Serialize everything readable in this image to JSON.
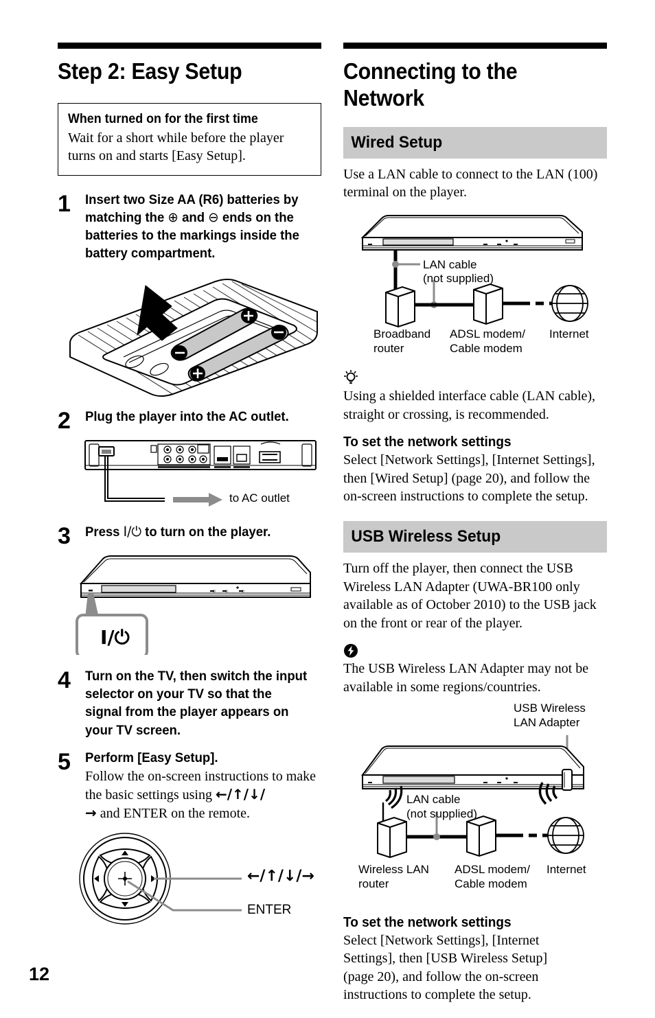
{
  "page": {
    "number": "12"
  },
  "left": {
    "rule": true,
    "title": "Step 2: Easy Setup",
    "first_time_box": {
      "heading": "When turned on for the first time",
      "text": "Wait for a short while before the player turns on and starts [Easy Setup]."
    },
    "steps": [
      {
        "num": "1",
        "heading_a": "Insert two Size AA (R6) batteries by matching the ",
        "plus": "⊕",
        "heading_b": " and ",
        "minus": "⊖",
        "heading_c": " ends on the batteries to the markings inside the battery compartment.",
        "figure": "remote-battery-compartment"
      },
      {
        "num": "2",
        "heading": "Plug the player into the AC outlet.",
        "figure": "player-rear-panel",
        "callout": "to AC outlet"
      },
      {
        "num": "3",
        "heading_a": "Press ",
        "power_symbol": "I/⏻",
        "heading_b": " to turn on the player.",
        "figure": "player-front-power-button",
        "callout": "I/⏻"
      },
      {
        "num": "4",
        "heading": "Turn on the TV, then switch the input selector on your TV so that the signal from the player appears on your TV screen."
      },
      {
        "num": "5",
        "heading": "Perform [Easy Setup].",
        "sub_a": "Follow the on-screen instructions to make the basic settings using ",
        "arrows_1": "←/↑/↓/",
        "arrows_2": "→",
        "sub_b": " and ENTER on the remote.",
        "figure": "remote-dpad",
        "callout_arrows": "←/↑/↓/→",
        "callout_enter": "ENTER"
      }
    ]
  },
  "right": {
    "rule": true,
    "title": "Connecting to the Network",
    "wired": {
      "band": "Wired Setup",
      "intro": "Use a LAN cable to connect to the LAN (100) terminal on the player.",
      "diagram": {
        "lan_cable_label_1": "LAN cable",
        "lan_cable_label_2": "(not supplied)",
        "router_label_1": "Broadband",
        "router_label_2": "router",
        "modem_label_1": "ADSL modem/",
        "modem_label_2": "Cable modem",
        "internet_label": "Internet"
      },
      "tip_icon": "lightbulb-tip-icon",
      "tip_text": "Using a shielded interface cable (LAN cable), straight or crossing, is recommended.",
      "settings_heading": "To set the network settings",
      "settings_text": "Select [Network Settings], [Internet Settings], then [Wired Setup] (page 20), and follow the on-screen instructions to complete the setup."
    },
    "usb": {
      "band": "USB Wireless Setup",
      "intro": "Turn off the player, then connect the USB Wireless LAN Adapter (UWA-BR100 only available as of October 2010) to the USB jack on the front or rear of the player.",
      "note_icon": "lightning-note-icon",
      "note_text": "The USB Wireless LAN Adapter may not be available in some regions/countries.",
      "diagram": {
        "adapter_label_1": "USB Wireless",
        "adapter_label_2": "LAN Adapter",
        "lan_cable_label_1": "LAN cable",
        "lan_cable_label_2": "(not supplied)",
        "router_label_1": "Wireless LAN",
        "router_label_2": "router",
        "modem_label_1": "ADSL modem/",
        "modem_label_2": "Cable modem",
        "internet_label": "Internet"
      },
      "settings_heading": "To set the network settings",
      "settings_text": "Select [Network Settings], [Internet Settings], then [USB Wireless Setup] (page 20), and follow the on-screen instructions to complete the setup."
    }
  },
  "colors": {
    "band_gray": "#c9c9c9",
    "ink": "#000000",
    "callout_gray": "#8c8c8c"
  }
}
